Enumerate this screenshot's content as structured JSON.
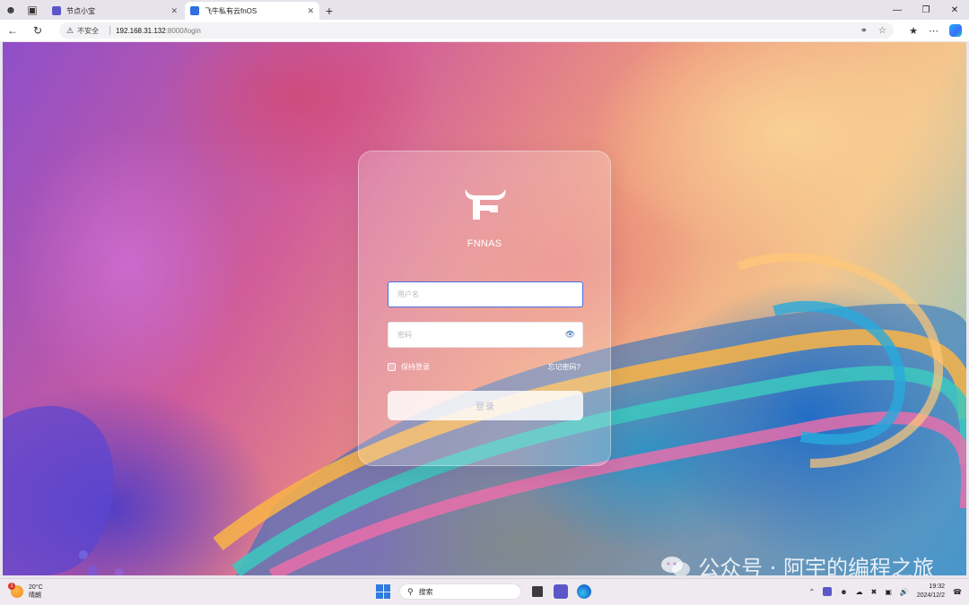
{
  "browser": {
    "tabs": [
      {
        "title": "节点小宝",
        "active": false
      },
      {
        "title": "飞牛私有云fnOS",
        "active": true
      }
    ],
    "address": {
      "security_label": "不安全",
      "host": "192.168.31.132",
      "path": ":8000/login"
    }
  },
  "login": {
    "brand": "FNNAS",
    "username_placeholder": "用户名",
    "password_placeholder": "密码",
    "remember_label": "保持登录",
    "forgot_label": "忘记密码?",
    "submit_label": "登录"
  },
  "watermark": {
    "text": "公众号 · 阿宇的编程之旅"
  },
  "taskbar": {
    "weather_temp": "20°C",
    "weather_desc": "晴朗",
    "weather_badge": "1",
    "search_label": "搜索",
    "time": "19:32",
    "date": "2024/12/2"
  },
  "colors": {
    "accent": "#4a6fe0",
    "brand_icon": "#5b57c9"
  }
}
